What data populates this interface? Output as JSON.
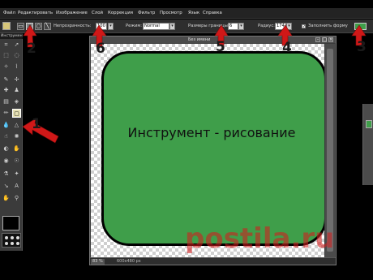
{
  "menubar": {
    "items": [
      "Файл",
      "Редактировать",
      "Изображение",
      "Слой",
      "Коррекция",
      "Фильтр",
      "Просмотр",
      "Язык",
      "Справка"
    ]
  },
  "options": {
    "opacity_label": "Непрозрачность:",
    "opacity_value": "100",
    "mode_label": "Режим:",
    "mode_value": "Normal",
    "border_label": "Размеры границы:",
    "border_value": "6",
    "radius_label": "Радиус:",
    "radius_value": "174",
    "fill_label": "Заполнить форму",
    "fill_color": "#3f9e4a"
  },
  "toolpanel": {
    "header": "Инструмент",
    "foreground_color": "#000000"
  },
  "document": {
    "title": "Без имени",
    "caption": "Инструмент - рисование",
    "zoom": "83",
    "zoom_unit": "%",
    "size": "600x480 px",
    "shape_color": "#3f9e4a"
  },
  "annotations": {
    "labels": [
      "1",
      "2",
      "3",
      "4",
      "5",
      "6"
    ],
    "arrow_color": "#d01818"
  },
  "watermark": "postila.ru"
}
